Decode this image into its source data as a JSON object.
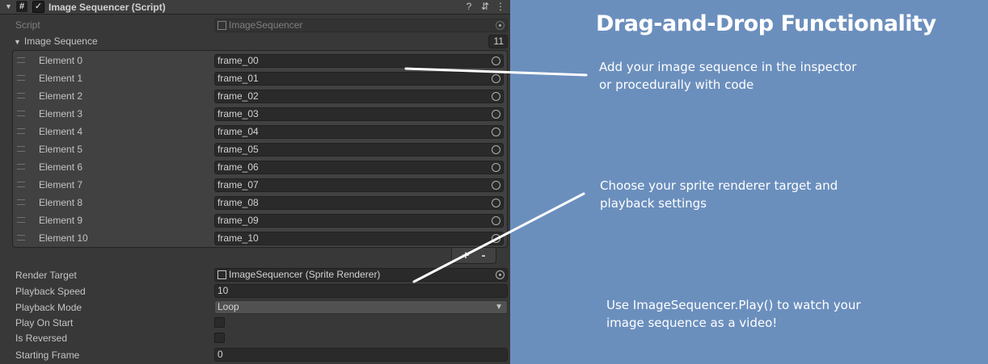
{
  "component": {
    "title": "Image Sequencer (Script)",
    "script_icon": "#",
    "enabled_check": "✓"
  },
  "header_icons": {
    "help": "?",
    "presets": "⇵",
    "menu": "⋮",
    "fold": "▼"
  },
  "script_field": {
    "label": "Script",
    "value": "ImageSequencer"
  },
  "image_sequence": {
    "label": "Image Sequence",
    "count": "11",
    "elements": [
      {
        "label": "Element 0",
        "value": "frame_00"
      },
      {
        "label": "Element 1",
        "value": "frame_01"
      },
      {
        "label": "Element 2",
        "value": "frame_02"
      },
      {
        "label": "Element 3",
        "value": "frame_03"
      },
      {
        "label": "Element 4",
        "value": "frame_04"
      },
      {
        "label": "Element 5",
        "value": "frame_05"
      },
      {
        "label": "Element 6",
        "value": "frame_06"
      },
      {
        "label": "Element 7",
        "value": "frame_07"
      },
      {
        "label": "Element 8",
        "value": "frame_08"
      },
      {
        "label": "Element 9",
        "value": "frame_09"
      },
      {
        "label": "Element 10",
        "value": "frame_10"
      }
    ],
    "add_label": "+",
    "remove_label": "-"
  },
  "render_target": {
    "label": "Render Target",
    "value": "ImageSequencer (Sprite Renderer)"
  },
  "playback_speed": {
    "label": "Playback Speed",
    "value": "10"
  },
  "playback_mode": {
    "label": "Playback Mode",
    "value": "Loop",
    "arrow": "▼"
  },
  "play_on_start": {
    "label": "Play On Start",
    "checked": false
  },
  "is_reversed": {
    "label": "Is Reversed",
    "checked": false
  },
  "starting_frame": {
    "label": "Starting Frame",
    "value": "0"
  },
  "promo": {
    "title": "Drag-and-Drop Functionality",
    "note1": "Add your image sequence in the inspector or procedurally with code",
    "note2": "Choose your sprite renderer target and playback settings",
    "note3": "Use ImageSequencer.Play() to watch your image sequence as a video!",
    "background": "#6b8fbd"
  },
  "colors": {
    "inspector_bg": "#383838",
    "field_bg": "#2a2a2a",
    "text": "#c4c4c4",
    "annotation_line": "#ffffff"
  }
}
